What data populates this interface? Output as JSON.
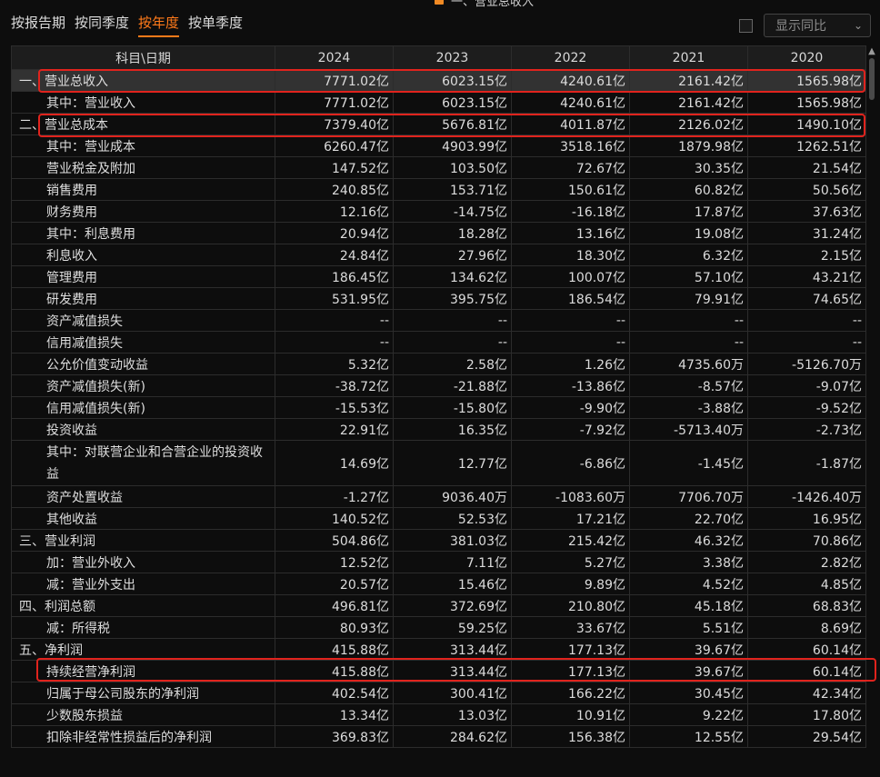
{
  "header": {
    "top_legend": "一、营业总收入",
    "tabs": [
      {
        "label": "按报告期",
        "active": false
      },
      {
        "label": "按同季度",
        "active": false
      },
      {
        "label": "按年度",
        "active": true
      },
      {
        "label": "按单季度",
        "active": false
      }
    ],
    "yoy_label": "显示同比"
  },
  "table": {
    "columns": [
      "科目\\日期",
      "2024",
      "2023",
      "2022",
      "2021",
      "2020"
    ],
    "rows": [
      {
        "label": "一、营业总收入",
        "values": [
          "7771.02亿",
          "6023.15亿",
          "4240.61亿",
          "2161.42亿",
          "1565.98亿"
        ]
      },
      {
        "label": "其中：营业收入",
        "values": [
          "7771.02亿",
          "6023.15亿",
          "4240.61亿",
          "2161.42亿",
          "1565.98亿"
        ]
      },
      {
        "label": "二、营业总成本",
        "values": [
          "7379.40亿",
          "5676.81亿",
          "4011.87亿",
          "2126.02亿",
          "1490.10亿"
        ]
      },
      {
        "label": "其中：营业成本",
        "values": [
          "6260.47亿",
          "4903.99亿",
          "3518.16亿",
          "1879.98亿",
          "1262.51亿"
        ]
      },
      {
        "label": "营业税金及附加",
        "values": [
          "147.52亿",
          "103.50亿",
          "72.67亿",
          "30.35亿",
          "21.54亿"
        ]
      },
      {
        "label": "销售费用",
        "values": [
          "240.85亿",
          "153.71亿",
          "150.61亿",
          "60.82亿",
          "50.56亿"
        ]
      },
      {
        "label": "财务费用",
        "values": [
          "12.16亿",
          "-14.75亿",
          "-16.18亿",
          "17.87亿",
          "37.63亿"
        ]
      },
      {
        "label": "其中：利息费用",
        "values": [
          "20.94亿",
          "18.28亿",
          "13.16亿",
          "19.08亿",
          "31.24亿"
        ]
      },
      {
        "label": "利息收入",
        "values": [
          "24.84亿",
          "27.96亿",
          "18.30亿",
          "6.32亿",
          "2.15亿"
        ]
      },
      {
        "label": "管理费用",
        "values": [
          "186.45亿",
          "134.62亿",
          "100.07亿",
          "57.10亿",
          "43.21亿"
        ]
      },
      {
        "label": "研发费用",
        "values": [
          "531.95亿",
          "395.75亿",
          "186.54亿",
          "79.91亿",
          "74.65亿"
        ]
      },
      {
        "label": "资产减值损失",
        "values": [
          "--",
          "--",
          "--",
          "--",
          "--"
        ]
      },
      {
        "label": "信用减值损失",
        "values": [
          "--",
          "--",
          "--",
          "--",
          "--"
        ]
      },
      {
        "label": "公允价值变动收益",
        "values": [
          "5.32亿",
          "2.58亿",
          "1.26亿",
          "4735.60万",
          "-5126.70万"
        ]
      },
      {
        "label": "资产减值损失(新)",
        "values": [
          "-38.72亿",
          "-21.88亿",
          "-13.86亿",
          "-8.57亿",
          "-9.07亿"
        ]
      },
      {
        "label": "信用减值损失(新)",
        "values": [
          "-15.53亿",
          "-15.80亿",
          "-9.90亿",
          "-3.88亿",
          "-9.52亿"
        ]
      },
      {
        "label": "投资收益",
        "values": [
          "22.91亿",
          "16.35亿",
          "-7.92亿",
          "-5713.40万",
          "-2.73亿"
        ]
      },
      {
        "label": "其中：对联营企业和合营企业的投资收益",
        "values": [
          "14.69亿",
          "12.77亿",
          "-6.86亿",
          "-1.45亿",
          "-1.87亿"
        ]
      },
      {
        "label": "资产处置收益",
        "values": [
          "-1.27亿",
          "9036.40万",
          "-1083.60万",
          "7706.70万",
          "-1426.40万"
        ]
      },
      {
        "label": "其他收益",
        "values": [
          "140.52亿",
          "52.53亿",
          "17.21亿",
          "22.70亿",
          "16.95亿"
        ]
      },
      {
        "label": "三、营业利润",
        "values": [
          "504.86亿",
          "381.03亿",
          "215.42亿",
          "46.32亿",
          "70.86亿"
        ]
      },
      {
        "label": "加：营业外收入",
        "values": [
          "12.52亿",
          "7.11亿",
          "5.27亿",
          "3.38亿",
          "2.82亿"
        ]
      },
      {
        "label": "减：营业外支出",
        "values": [
          "20.57亿",
          "15.46亿",
          "9.89亿",
          "4.52亿",
          "4.85亿"
        ]
      },
      {
        "label": "四、利润总额",
        "values": [
          "496.81亿",
          "372.69亿",
          "210.80亿",
          "45.18亿",
          "68.83亿"
        ]
      },
      {
        "label": "减：所得税",
        "values": [
          "80.93亿",
          "59.25亿",
          "33.67亿",
          "5.51亿",
          "8.69亿"
        ]
      },
      {
        "label": "五、净利润",
        "values": [
          "415.88亿",
          "313.44亿",
          "177.13亿",
          "39.67亿",
          "60.14亿"
        ]
      },
      {
        "label": "持续经营净利润",
        "values": [
          "415.88亿",
          "313.44亿",
          "177.13亿",
          "39.67亿",
          "60.14亿"
        ]
      },
      {
        "label": "归属于母公司股东的净利润",
        "values": [
          "402.54亿",
          "300.41亿",
          "166.22亿",
          "30.45亿",
          "42.34亿"
        ]
      },
      {
        "label": "少数股东损益",
        "values": [
          "13.34亿",
          "13.03亿",
          "10.91亿",
          "9.22亿",
          "17.80亿"
        ]
      },
      {
        "label": "扣除非经常性损益后的净利润",
        "values": [
          "369.83亿",
          "284.62亿",
          "156.38亿",
          "12.55亿",
          "29.54亿"
        ]
      }
    ]
  },
  "colors": {
    "accent": "#ff7a1a",
    "highlight_border": "#e0231d",
    "background": "#0d0d0d"
  }
}
